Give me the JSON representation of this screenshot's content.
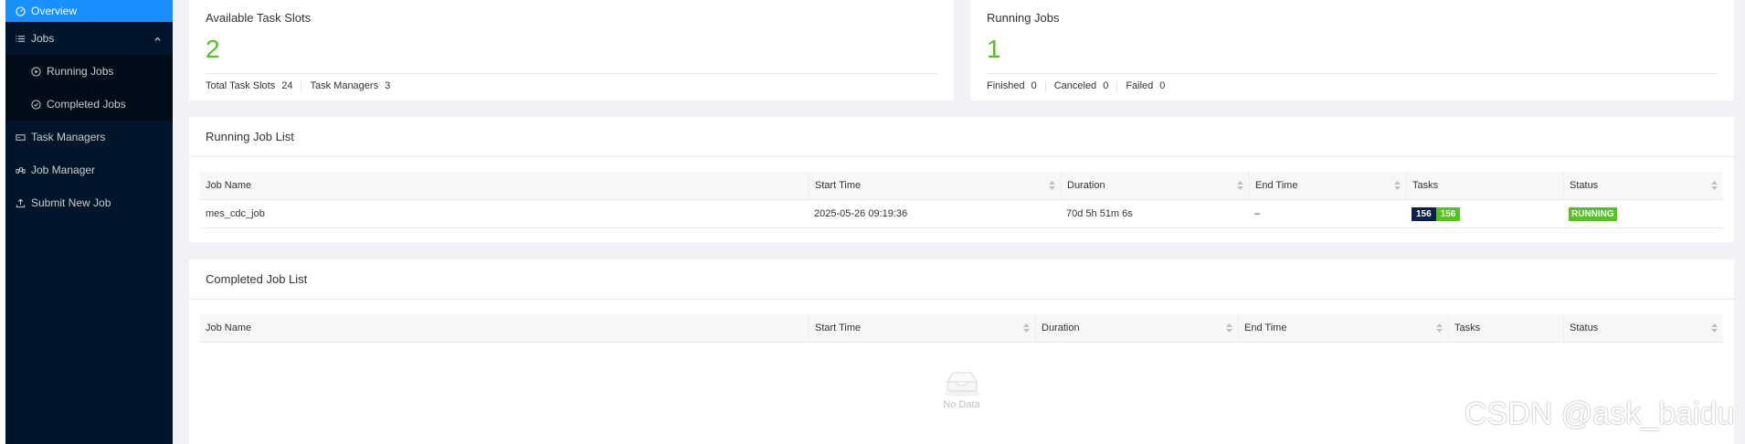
{
  "sidebar": {
    "overview": "Overview",
    "jobs": "Jobs",
    "running_jobs": "Running Jobs",
    "completed_jobs": "Completed Jobs",
    "task_managers": "Task Managers",
    "job_manager": "Job Manager",
    "submit_new_job": "Submit New Job"
  },
  "task_slots_card": {
    "title": "Available Task Slots",
    "value": "2",
    "total_label": "Total Task Slots",
    "total_value": "24",
    "tm_label": "Task Managers",
    "tm_value": "3"
  },
  "running_jobs_card": {
    "title": "Running Jobs",
    "value": "1",
    "finished_label": "Finished",
    "finished_value": "0",
    "canceled_label": "Canceled",
    "canceled_value": "0",
    "failed_label": "Failed",
    "failed_value": "0"
  },
  "running_list": {
    "title": "Running Job List",
    "columns": [
      "Job Name",
      "Start Time",
      "Duration",
      "End Time",
      "Tasks",
      "Status"
    ],
    "rows": [
      {
        "job_name": "mes_cdc_job",
        "start_time": "2025-05-26 09:19:36",
        "duration": "70d 5h 51m 6s",
        "end_time": "–",
        "tasks_total": "156",
        "tasks_running": "156",
        "status": "RUNNING"
      }
    ]
  },
  "completed_list": {
    "title": "Completed Job List",
    "columns": [
      "Job Name",
      "Start Time",
      "Duration",
      "End Time",
      "Tasks",
      "Status"
    ],
    "empty_text": "No Data"
  },
  "watermark": "CSDN @ask_baidu",
  "colors": {
    "sidebar_bg": "#001529",
    "active_menu": "#1890ff",
    "success_green": "#52c41a",
    "badge_navy": "#0b1f4b"
  }
}
